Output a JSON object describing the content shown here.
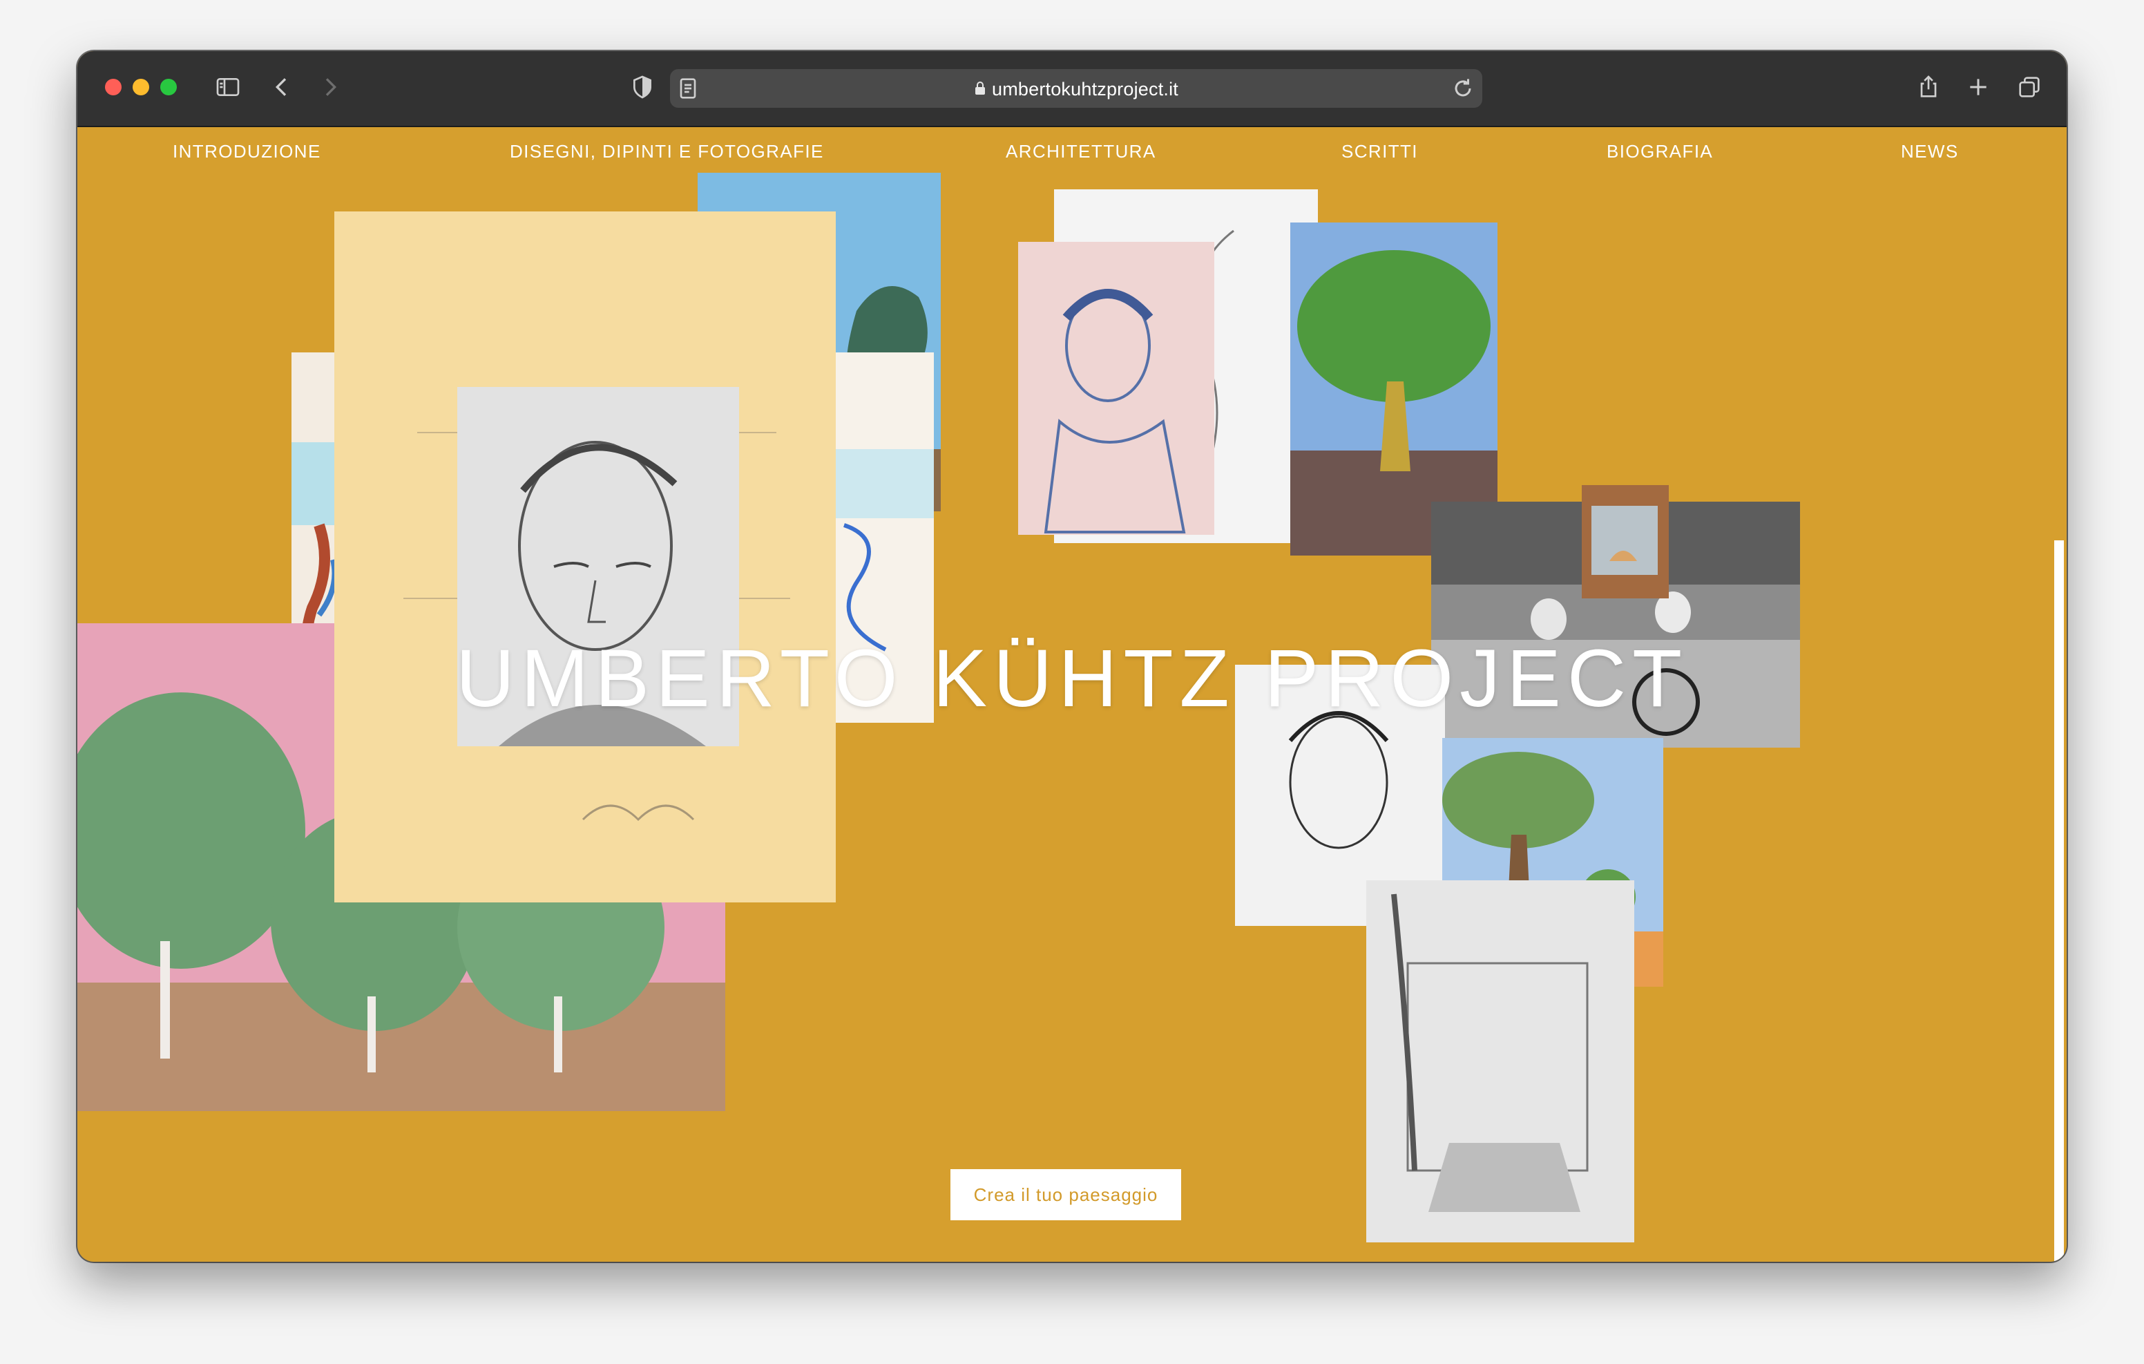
{
  "browser": {
    "url": "umbertokuhtzproject.it",
    "traffic_lights": [
      "#ff5f57",
      "#febc2e",
      "#28c840"
    ],
    "icons": [
      "sidebar-icon",
      "back-icon",
      "forward-icon",
      "shield-icon",
      "reader-icon",
      "lock-icon",
      "reload-icon",
      "share-icon",
      "new-tab-icon",
      "tabs-overview-icon"
    ]
  },
  "nav": {
    "items": [
      {
        "label": "INTRODUZIONE"
      },
      {
        "label": "DISEGNI, DIPINTI E FOTOGRAFIE"
      },
      {
        "label": "ARCHITETTURA"
      },
      {
        "label": "SCRITTI"
      },
      {
        "label": "BIOGRAFIA"
      },
      {
        "label": "NEWS"
      }
    ]
  },
  "hero": {
    "title": "UMBERTO KÜHTZ PROJECT",
    "cta_label": "Crea il tuo paesaggio"
  },
  "colors": {
    "page_background": "#d69f2e",
    "browser_chrome": "#323232",
    "cta_text": "#d29a2a"
  }
}
